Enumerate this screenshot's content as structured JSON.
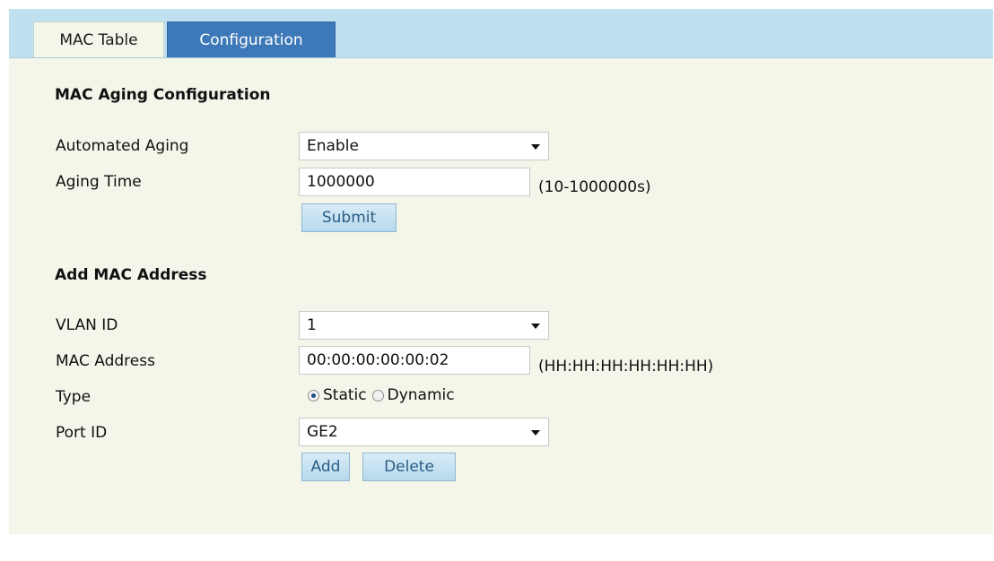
{
  "tabs": {
    "mac_table": "MAC Table",
    "configuration": "Configuration"
  },
  "aging": {
    "title": "MAC Aging Configuration",
    "automated_aging_label": "Automated Aging",
    "automated_aging_value": "Enable",
    "aging_time_label": "Aging Time",
    "aging_time_value": "1000000",
    "aging_time_hint": "(10-1000000s)",
    "submit_label": "Submit"
  },
  "add_mac": {
    "title": "Add MAC Address",
    "vlan_id_label": "VLAN ID",
    "vlan_id_value": "1",
    "mac_address_label": "MAC Address",
    "mac_address_value": "00:00:00:00:00:02",
    "mac_address_hint": "(HH:HH:HH:HH:HH:HH)",
    "type_label": "Type",
    "type_options": {
      "static": "Static",
      "dynamic": "Dynamic"
    },
    "type_selected": "static",
    "port_id_label": "Port ID",
    "port_id_value": "GE2",
    "add_label": "Add",
    "delete_label": "Delete"
  },
  "colors": {
    "tabbar": "#bfe1ef",
    "active_tab": "#3d79b8",
    "panel": "#f3f6e9",
    "button": "#c7e2f2"
  },
  "icons": {
    "dropdown": "chevron-down-icon",
    "radio": "radio-icon"
  }
}
